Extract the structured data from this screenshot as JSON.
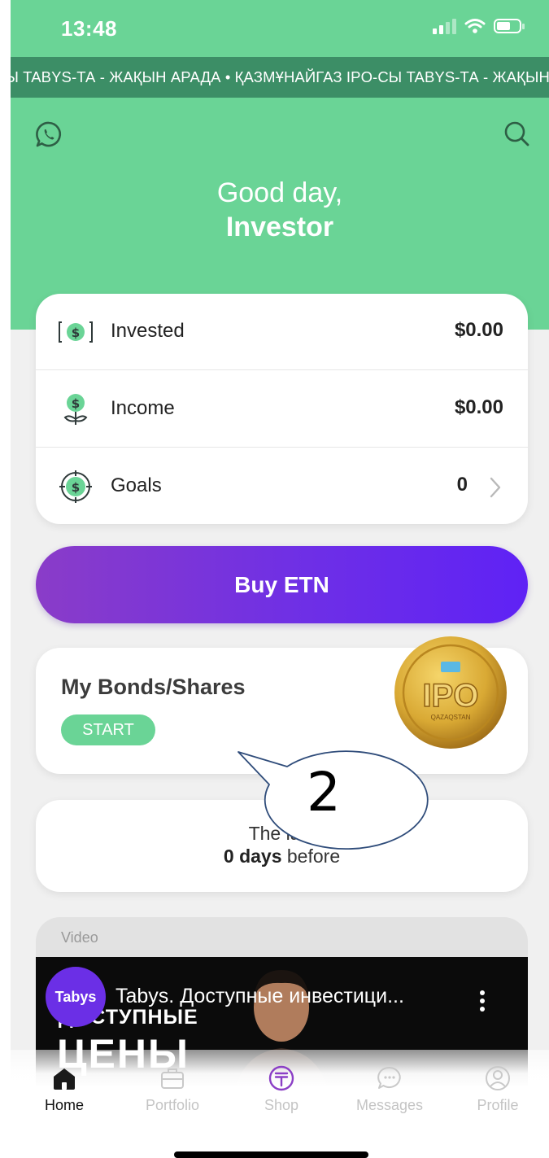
{
  "status_bar": {
    "time": "13:48",
    "battery_level": 0.6
  },
  "ticker": {
    "text": "СЫ TABYS-ТА - ЖАҚЫН АРАДА • ҚАЗМҰНАЙГАЗ IPO-СЫ TABYS-ТА - ЖАҚЫН АРАДА • ҚАЗМҰНАЙГАЗ IPO-"
  },
  "header": {
    "greeting": "Good day,",
    "name": "Investor"
  },
  "stats": [
    {
      "label": "Invested",
      "value": "$0.00",
      "icon": "dollar-bill-icon"
    },
    {
      "label": "Income",
      "value": "$0.00",
      "icon": "money-plant-icon"
    },
    {
      "label": "Goals",
      "value": "0",
      "icon": "target-dollar-icon"
    }
  ],
  "buy_button": {
    "label": "Buy ETN"
  },
  "bonds": {
    "title": "My Bonds/Shares",
    "start_label": "START",
    "coin_text": "IPO",
    "coin_subtext": "QAZAQSTAN"
  },
  "last_update": {
    "line1": "The last",
    "days": "0 days",
    "suffix": " before"
  },
  "callout": {
    "number": "2"
  },
  "video": {
    "section_label": "Video",
    "channel_logo": "Tabys",
    "title": "Tabys. Доступные инвестици...",
    "overlay_line1": "ДОСТУПНЫЕ",
    "overlay_line2": "ЦЕНЫ"
  },
  "tabs": [
    {
      "label": "Home",
      "icon": "home-icon",
      "active": true
    },
    {
      "label": "Portfolio",
      "icon": "briefcase-icon",
      "active": false
    },
    {
      "label": "Shop",
      "icon": "tenge-icon",
      "active": false
    },
    {
      "label": "Messages",
      "icon": "chat-bubble-icon",
      "active": false
    },
    {
      "label": "Profile",
      "icon": "user-icon",
      "active": false
    }
  ],
  "colors": {
    "brand_green": "#6ad496",
    "ticker_green": "#3c8e66",
    "button_gradient_start": "#8a3cc8",
    "button_gradient_end": "#5f22f5",
    "shop_purple": "#8b3fc6"
  }
}
